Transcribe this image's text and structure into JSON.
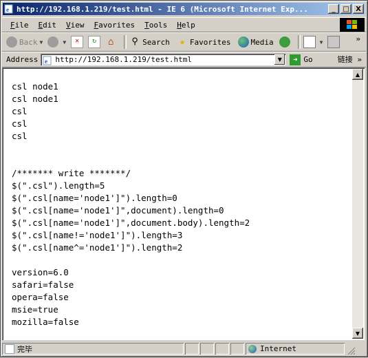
{
  "window": {
    "title": "http://192.168.1.219/test.html - IE 6 (Microsoft Internet Exp...",
    "min_glyph": "_",
    "max_glyph": "□",
    "close_glyph": "X"
  },
  "menu": [
    {
      "label": "File",
      "u": "F",
      "rest": "ile"
    },
    {
      "label": "Edit",
      "u": "E",
      "rest": "dit"
    },
    {
      "label": "View",
      "u": "V",
      "rest": "iew"
    },
    {
      "label": "Favorites",
      "u": "F",
      "rest": "avorites"
    },
    {
      "label": "Tools",
      "u": "T",
      "rest": "ools"
    },
    {
      "label": "Help",
      "u": "H",
      "rest": "elp"
    }
  ],
  "toolbar": {
    "back": "Back",
    "search": "Search",
    "favorites": "Favorites",
    "media": "Media",
    "chevron": "»"
  },
  "address": {
    "label": "Address",
    "url": "http://192.168.1.219/test.html",
    "go": "Go",
    "links": "链接 »"
  },
  "page": {
    "lines": [
      "csl node1",
      "csl node1",
      "csl",
      "csl",
      "csl",
      "",
      "",
      "/******* write *******/",
      "$(\".csl\").length=5",
      "$(\".csl[name='node1']\").length=0",
      "$(\".csl[name='node1']\",document).length=0",
      "$(\".csl[name='node1']\",document.body).length=2",
      "$(\".csl[name!='node1']\").length=3",
      "$(\".csl[name^='node1']\").length=2",
      "",
      "version=6.0",
      "safari=false",
      "opera=false",
      "msie=true",
      "mozilla=false"
    ]
  },
  "status": {
    "text": "完毕",
    "zone": "Internet"
  },
  "colors": {
    "titlebar_start": "#0a246a",
    "titlebar_end": "#a6caf0",
    "chrome": "#d4d0c8"
  },
  "icons": [
    "ie-page-icon",
    "minimize-icon",
    "maximize-icon",
    "close-icon",
    "windows-logo-icon",
    "back-icon",
    "forward-icon",
    "stop-icon",
    "refresh-icon",
    "home-icon",
    "search-icon",
    "favorites-icon",
    "media-icon",
    "history-icon",
    "mail-icon",
    "print-icon",
    "go-icon",
    "globe-icon"
  ]
}
